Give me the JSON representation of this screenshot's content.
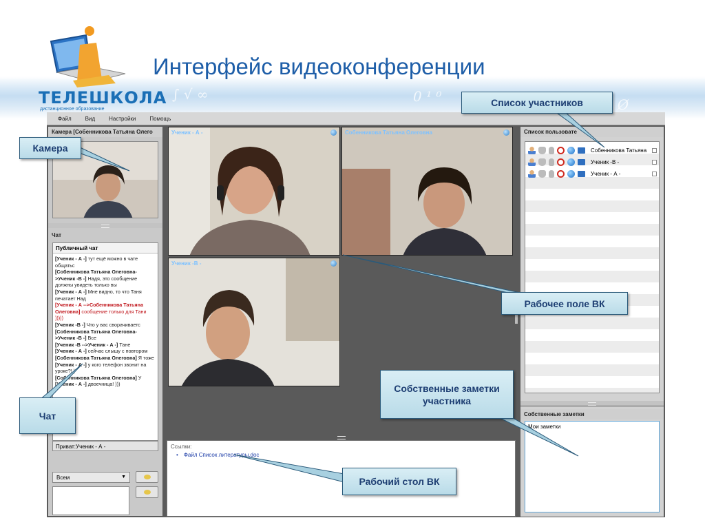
{
  "slide": {
    "title": "Интерфейс видеоконференции",
    "logo_name": "ТЕЛЕШКОЛА",
    "logo_tagline": "дистанционное образование"
  },
  "menu": [
    "Файл",
    "Вид",
    "Настройки",
    "Помощь"
  ],
  "camera": {
    "header": "Камера [Собенникова Татьяна Олего"
  },
  "chat": {
    "header": "Чат",
    "tab": "Публичный чат",
    "messages": [
      {
        "from": "[Ученик - А -]",
        "text": "тут ещё можно в чате общатьс",
        "private": false
      },
      {
        "from": "[Собенникова Татьяна Олеговна->Ученик -В -]",
        "text": "Надя, это сообщение должны увидеть только вы",
        "private": false
      },
      {
        "from": "[Ученик - А -]",
        "text": "Мне видно, то что Таня печатает Над",
        "private": false
      },
      {
        "from": "[Ученик - А -->Собенникова Татьяна Олеговна]",
        "text": "сообщение только для Тани )))))",
        "private": true
      },
      {
        "from": "[Ученик -В -]",
        "text": "Что у вас сворачиваетс",
        "private": false
      },
      {
        "from": "[Собенникова Татьяна Олеговна->Ученик -В -]",
        "text": "Все",
        "private": false
      },
      {
        "from": "[Ученик -В -->Ученик - А -]",
        "text": "Тане",
        "private": false
      },
      {
        "from": "[Ученик - А -]",
        "text": "сейчас слышу с повтором",
        "private": false
      },
      {
        "from": "[Собенникова Татьяна Олеговна]",
        "text": "Я тоже",
        "private": false
      },
      {
        "from": "[Ученик - А -]",
        "text": "у кого телефон звонит на уроке?! )",
        "private": false
      },
      {
        "from": "[Собенникова Татьяна Олеговна]",
        "text": "У",
        "private": false
      },
      {
        "from": "[Ученик - А -]",
        "text": "двоечница! )))",
        "private": false
      }
    ],
    "private_to": "Приват:Ученик - А -",
    "recipient": "Всем"
  },
  "videos": [
    {
      "label": "Ученик - А -"
    },
    {
      "label": "Собенникова Татьяна Олеговна"
    },
    {
      "label": "Ученик -В -"
    }
  ],
  "desktop": {
    "header": "Ссылки:",
    "items": [
      "Файл Список литературы.doc"
    ]
  },
  "users": {
    "header": "Список пользовате",
    "rows": [
      {
        "name": "Собенникова Татьяна",
        "checked": false
      },
      {
        "name": "Ученик -В -",
        "checked": false
      },
      {
        "name": "Ученик - А -",
        "checked": false
      }
    ]
  },
  "notes": {
    "header": "Собственные заметки",
    "text": "Мои заметки"
  },
  "callouts": {
    "participants": "Список участников",
    "camera": "Камера",
    "workspace": "Рабочее поле ВК",
    "notes": "Собственные заметки участника",
    "chat": "Чат",
    "desktop": "Рабочий стол ВК"
  },
  "colors": {
    "title": "#1e5ea8",
    "callout_text": "#1e3f73",
    "private_message": "#c0151b",
    "video_label": "#7fc2ff"
  }
}
